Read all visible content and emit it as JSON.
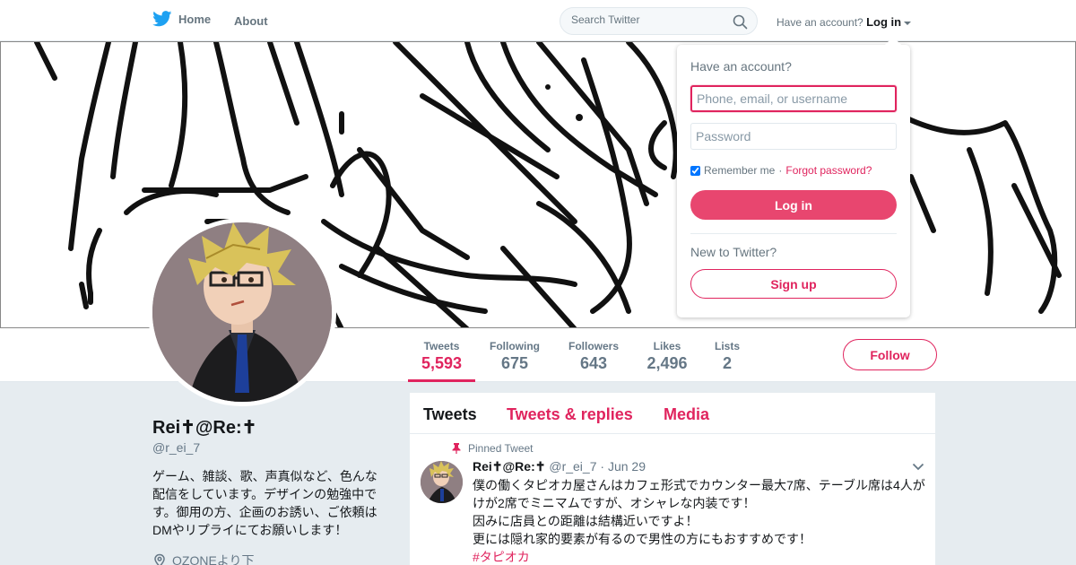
{
  "nav": {
    "home_label": "Home",
    "about_label": "About",
    "search_placeholder": "Search Twitter",
    "have_account": "Have an account?",
    "login_label": "Log in"
  },
  "profile": {
    "name": "Rei✝@Re:✝",
    "handle": "@r_ei_7",
    "bio": "ゲーム、雑談、歌、声真似など、色んな配信をしています。デザインの勉強中です。御用の方、企画のお誘い、ご依頼はDMやリプライにてお願いします！",
    "location": "OZONEより下"
  },
  "stats": [
    {
      "label": "Tweets",
      "value": "5,593"
    },
    {
      "label": "Following",
      "value": "675"
    },
    {
      "label": "Followers",
      "value": "643"
    },
    {
      "label": "Likes",
      "value": "2,496"
    },
    {
      "label": "Lists",
      "value": "2"
    }
  ],
  "follow_label": "Follow",
  "tabs": [
    "Tweets",
    "Tweets & replies",
    "Media"
  ],
  "tweet": {
    "pinned_label": "Pinned Tweet",
    "name": "Rei✝@Re:✝",
    "handle": "@r_ei_7",
    "date": "· Jun 29",
    "line1": "僕の働くタピオカ屋さんはカフェ形式でカウンター最大7席、テーブル席は4人がけが2席でミニマムですが、オシャレな内装です！",
    "line2": "因みに店員との距離は結構近いですよ！",
    "line3": "更には隠れ家的要素が有るので男性の方にもおすすめです！",
    "hashtag": "#タピオカ"
  },
  "login": {
    "title": "Have an account?",
    "username_placeholder": "Phone, email, or username",
    "password_placeholder": "Password",
    "remember_label": "Remember me",
    "separator": "·",
    "forgot_label": "Forgot password?",
    "login_button": "Log in",
    "new_label": "New to Twitter?",
    "signup_button": "Sign up"
  },
  "colors": {
    "accent": "#e0245e",
    "twitter_blue": "#1da1f2",
    "page_bg": "#e6ecf0"
  },
  "icons": [
    "twitter-bird-icon",
    "search-icon",
    "caret-down-icon",
    "pin-icon",
    "location-icon",
    "chevron-down-icon"
  ]
}
